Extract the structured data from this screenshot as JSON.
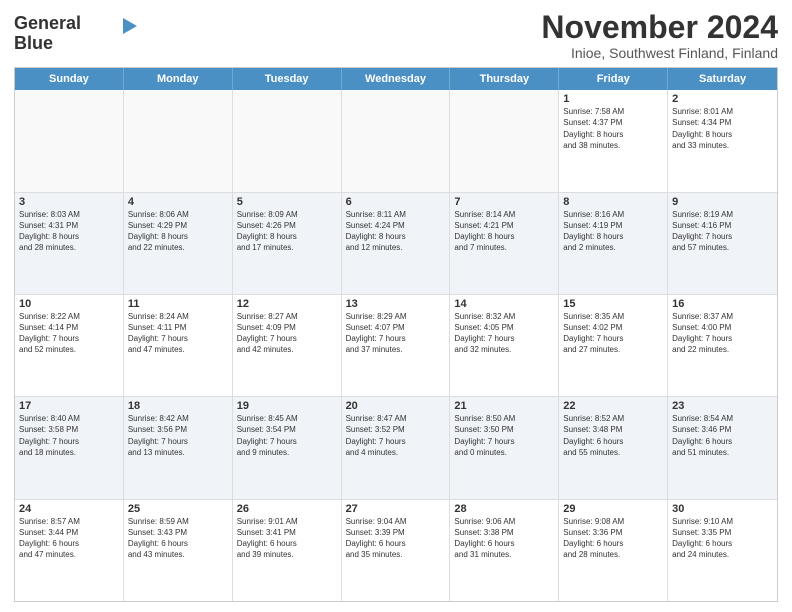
{
  "logo": {
    "general": "General",
    "blue": "Blue"
  },
  "title": "November 2024",
  "subtitle": "Inioe, Southwest Finland, Finland",
  "days_header": [
    "Sunday",
    "Monday",
    "Tuesday",
    "Wednesday",
    "Thursday",
    "Friday",
    "Saturday"
  ],
  "rows": [
    [
      {
        "day": "",
        "info": ""
      },
      {
        "day": "",
        "info": ""
      },
      {
        "day": "",
        "info": ""
      },
      {
        "day": "",
        "info": ""
      },
      {
        "day": "",
        "info": ""
      },
      {
        "day": "1",
        "info": "Sunrise: 7:58 AM\nSunset: 4:37 PM\nDaylight: 8 hours\nand 38 minutes."
      },
      {
        "day": "2",
        "info": "Sunrise: 8:01 AM\nSunset: 4:34 PM\nDaylight: 8 hours\nand 33 minutes."
      }
    ],
    [
      {
        "day": "3",
        "info": "Sunrise: 8:03 AM\nSunset: 4:31 PM\nDaylight: 8 hours\nand 28 minutes."
      },
      {
        "day": "4",
        "info": "Sunrise: 8:06 AM\nSunset: 4:29 PM\nDaylight: 8 hours\nand 22 minutes."
      },
      {
        "day": "5",
        "info": "Sunrise: 8:09 AM\nSunset: 4:26 PM\nDaylight: 8 hours\nand 17 minutes."
      },
      {
        "day": "6",
        "info": "Sunrise: 8:11 AM\nSunset: 4:24 PM\nDaylight: 8 hours\nand 12 minutes."
      },
      {
        "day": "7",
        "info": "Sunrise: 8:14 AM\nSunset: 4:21 PM\nDaylight: 8 hours\nand 7 minutes."
      },
      {
        "day": "8",
        "info": "Sunrise: 8:16 AM\nSunset: 4:19 PM\nDaylight: 8 hours\nand 2 minutes."
      },
      {
        "day": "9",
        "info": "Sunrise: 8:19 AM\nSunset: 4:16 PM\nDaylight: 7 hours\nand 57 minutes."
      }
    ],
    [
      {
        "day": "10",
        "info": "Sunrise: 8:22 AM\nSunset: 4:14 PM\nDaylight: 7 hours\nand 52 minutes."
      },
      {
        "day": "11",
        "info": "Sunrise: 8:24 AM\nSunset: 4:11 PM\nDaylight: 7 hours\nand 47 minutes."
      },
      {
        "day": "12",
        "info": "Sunrise: 8:27 AM\nSunset: 4:09 PM\nDaylight: 7 hours\nand 42 minutes."
      },
      {
        "day": "13",
        "info": "Sunrise: 8:29 AM\nSunset: 4:07 PM\nDaylight: 7 hours\nand 37 minutes."
      },
      {
        "day": "14",
        "info": "Sunrise: 8:32 AM\nSunset: 4:05 PM\nDaylight: 7 hours\nand 32 minutes."
      },
      {
        "day": "15",
        "info": "Sunrise: 8:35 AM\nSunset: 4:02 PM\nDaylight: 7 hours\nand 27 minutes."
      },
      {
        "day": "16",
        "info": "Sunrise: 8:37 AM\nSunset: 4:00 PM\nDaylight: 7 hours\nand 22 minutes."
      }
    ],
    [
      {
        "day": "17",
        "info": "Sunrise: 8:40 AM\nSunset: 3:58 PM\nDaylight: 7 hours\nand 18 minutes."
      },
      {
        "day": "18",
        "info": "Sunrise: 8:42 AM\nSunset: 3:56 PM\nDaylight: 7 hours\nand 13 minutes."
      },
      {
        "day": "19",
        "info": "Sunrise: 8:45 AM\nSunset: 3:54 PM\nDaylight: 7 hours\nand 9 minutes."
      },
      {
        "day": "20",
        "info": "Sunrise: 8:47 AM\nSunset: 3:52 PM\nDaylight: 7 hours\nand 4 minutes."
      },
      {
        "day": "21",
        "info": "Sunrise: 8:50 AM\nSunset: 3:50 PM\nDaylight: 7 hours\nand 0 minutes."
      },
      {
        "day": "22",
        "info": "Sunrise: 8:52 AM\nSunset: 3:48 PM\nDaylight: 6 hours\nand 55 minutes."
      },
      {
        "day": "23",
        "info": "Sunrise: 8:54 AM\nSunset: 3:46 PM\nDaylight: 6 hours\nand 51 minutes."
      }
    ],
    [
      {
        "day": "24",
        "info": "Sunrise: 8:57 AM\nSunset: 3:44 PM\nDaylight: 6 hours\nand 47 minutes."
      },
      {
        "day": "25",
        "info": "Sunrise: 8:59 AM\nSunset: 3:43 PM\nDaylight: 6 hours\nand 43 minutes."
      },
      {
        "day": "26",
        "info": "Sunrise: 9:01 AM\nSunset: 3:41 PM\nDaylight: 6 hours\nand 39 minutes."
      },
      {
        "day": "27",
        "info": "Sunrise: 9:04 AM\nSunset: 3:39 PM\nDaylight: 6 hours\nand 35 minutes."
      },
      {
        "day": "28",
        "info": "Sunrise: 9:06 AM\nSunset: 3:38 PM\nDaylight: 6 hours\nand 31 minutes."
      },
      {
        "day": "29",
        "info": "Sunrise: 9:08 AM\nSunset: 3:36 PM\nDaylight: 6 hours\nand 28 minutes."
      },
      {
        "day": "30",
        "info": "Sunrise: 9:10 AM\nSunset: 3:35 PM\nDaylight: 6 hours\nand 24 minutes."
      }
    ]
  ]
}
